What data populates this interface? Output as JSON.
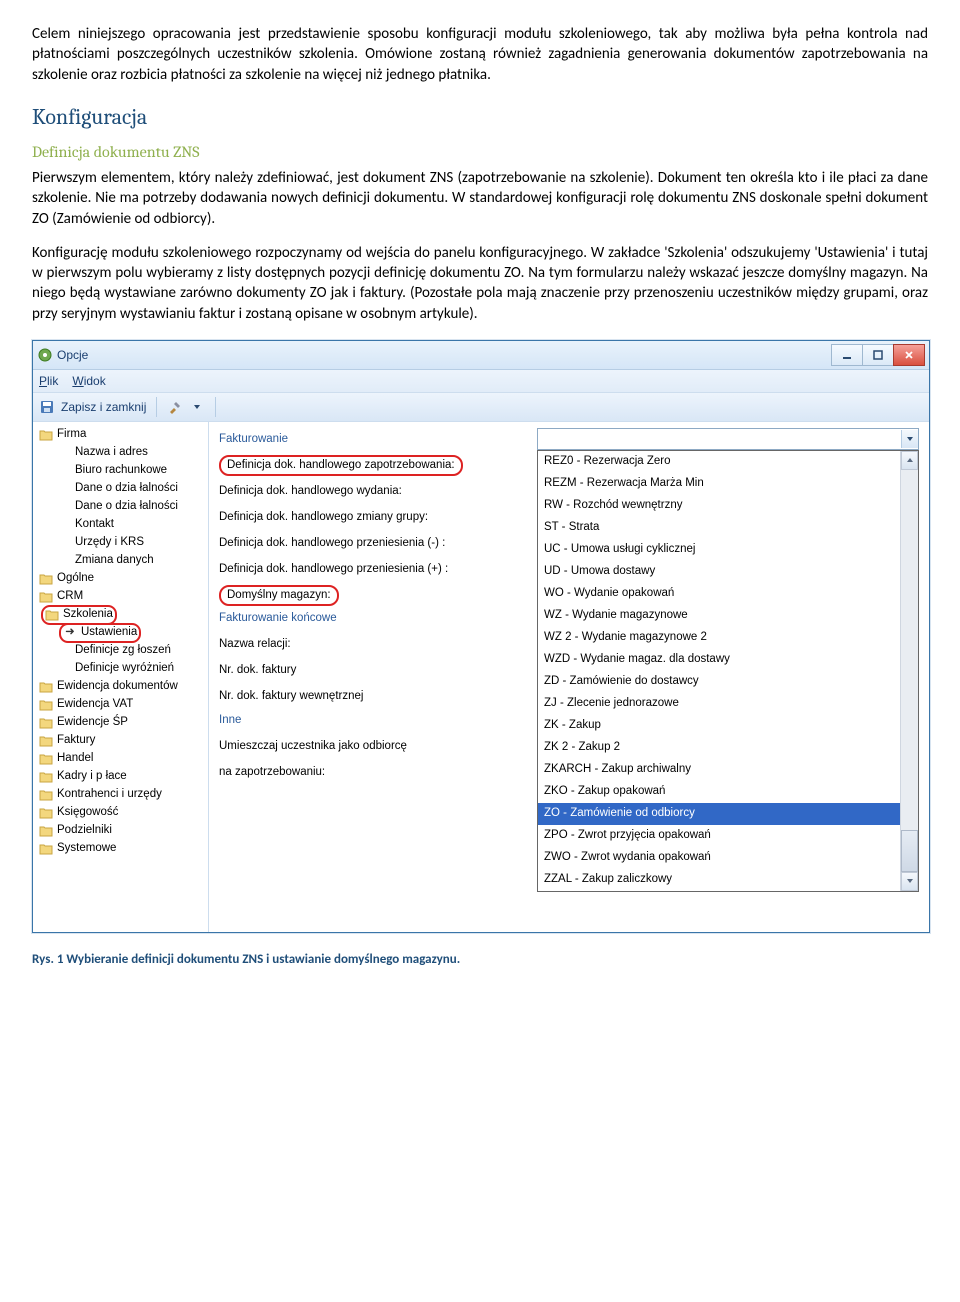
{
  "paragraphs": {
    "p1": "Celem niniejszego opracowania jest przedstawienie sposobu konfiguracji modułu szkoleniowego, tak aby możliwa była pełna kontrola nad płatnościami poszczególnych uczestników szkolenia. Omówione zostaną również zagadnienia generowania dokumentów zapotrzebowania na szkolenie oraz rozbicia płatności za szkolenie na więcej niż jednego płatnika.",
    "h2": "Konfiguracja",
    "h3": "Definicja dokumentu ZNS",
    "p2": "Pierwszym elementem, który należy zdefiniować, jest dokument ZNS (zapotrzebowanie na szkolenie). Dokument ten określa kto i ile płaci za dane szkolenie. Nie ma potrzeby dodawania nowych definicji dokumentu. W standardowej konfiguracji rolę dokumentu ZNS doskonale spełni dokument ZO (Zamówienie od odbiorcy).",
    "p3": "Konfigurację modułu szkoleniowego rozpoczynamy od wejścia do panelu konfiguracyjnego. W zakładce 'Szkolenia' odszukujemy 'Ustawienia' i tutaj w pierwszym polu wybieramy z listy dostępnych pozycji definicję dokumentu ZO. Na tym formularzu należy wskazać jeszcze domyślny magazyn. Na niego będą wystawiane zarówno dokumenty ZO jak i faktury. (Pozostałe pola mają znaczenie przy przenoszeniu uczestników między grupami, oraz przy seryjnym wystawianiu faktur i zostaną opisane w osobnym artykule).",
    "caption": "Rys. 1 Wybieranie definicji dokumentu ZNS i ustawianie domyślnego magazynu."
  },
  "window": {
    "title": "Opcje",
    "menu": {
      "plik": "Plik",
      "widok": "Widok"
    },
    "toolbar": {
      "save": "Zapisz i zamknij"
    }
  },
  "tree": {
    "nodes": [
      {
        "label": "Firma",
        "type": "folder"
      },
      {
        "label": "Nazwa i adres",
        "type": "child"
      },
      {
        "label": "Biuro rachunkowe",
        "type": "child"
      },
      {
        "label": "Dane o dzia łalności",
        "type": "child"
      },
      {
        "label": "Dane o dzia łalności",
        "type": "child"
      },
      {
        "label": "Kontakt",
        "type": "child"
      },
      {
        "label": "Urzędy i KRS",
        "type": "child"
      },
      {
        "label": "Zmiana danych",
        "type": "child"
      },
      {
        "label": "Ogólne",
        "type": "folder"
      },
      {
        "label": "CRM",
        "type": "folder"
      },
      {
        "label": "Szkolenia",
        "type": "folder",
        "circled": true
      },
      {
        "label": "Ustawienia",
        "type": "arrow",
        "circled": true
      },
      {
        "label": "Definicje zg łoszeń",
        "type": "child"
      },
      {
        "label": "Definicje wyróżnień",
        "type": "child"
      },
      {
        "label": "Ewidencja dokumentów",
        "type": "folder"
      },
      {
        "label": "Ewidencja VAT",
        "type": "folder"
      },
      {
        "label": "Ewidencje ŚP",
        "type": "folder"
      },
      {
        "label": "Faktury",
        "type": "folder"
      },
      {
        "label": "Handel",
        "type": "folder"
      },
      {
        "label": "Kadry i p łace",
        "type": "folder"
      },
      {
        "label": "Kontrahenci i urzędy",
        "type": "folder"
      },
      {
        "label": "Księgowość",
        "type": "folder"
      },
      {
        "label": "Podzielniki",
        "type": "folder"
      },
      {
        "label": "Systemowe",
        "type": "folder"
      }
    ]
  },
  "form": {
    "group1": "Fakturowanie",
    "rows1": [
      {
        "label": "Definicja dok. handlowego zapotrzebowania:",
        "circled": true
      },
      {
        "label": "Definicja dok. handlowego wydania:"
      },
      {
        "label": "Definicja dok. handlowego zmiany grupy:"
      },
      {
        "label": "Definicja dok. handlowego przeniesienia (-) :"
      },
      {
        "label": "Definicja dok. handlowego przeniesienia (+) :"
      },
      {
        "label": "Domyślny magazyn:",
        "circled": true
      }
    ],
    "group2": "Fakturowanie końcowe",
    "rows2": [
      {
        "label": "Nazwa relacji:"
      },
      {
        "label": "Nr. dok. faktury"
      },
      {
        "label": "Nr. dok. faktury wewnętrznej"
      }
    ],
    "group3": "Inne",
    "rows3": [
      {
        "label": "Umieszczaj uczestnika jako odbiorcę"
      },
      {
        "label": "na zapotrzebowaniu:"
      }
    ]
  },
  "dropdown": {
    "items": [
      "REZ0 - Rezerwacja Zero",
      "REZM - Rezerwacja Marża Min",
      "RW - Rozchód wewnętrzny",
      "ST - Strata",
      "UC - Umowa usługi cyklicznej",
      "UD - Umowa dostawy",
      "WO - Wydanie opakowań",
      "WZ - Wydanie magazynowe",
      "WZ 2 - Wydanie magazynowe 2",
      "WZD - Wydanie magaz. dla dostawy",
      "ZD - Zamówienie do dostawcy",
      "ZJ - Zlecenie jednorazowe",
      "ZK - Zakup",
      "ZK 2 - Zakup 2",
      "ZKARCH - Zakup archiwalny",
      "ZKO - Zakup opakowań",
      "ZO - Zamówienie od odbiorcy",
      "ZPO - Zwrot przyjęcia opakowań",
      "ZWO - Zwrot wydania opakowań",
      "ZZAL - Zakup zaliczkowy"
    ],
    "selected_index": 16
  }
}
